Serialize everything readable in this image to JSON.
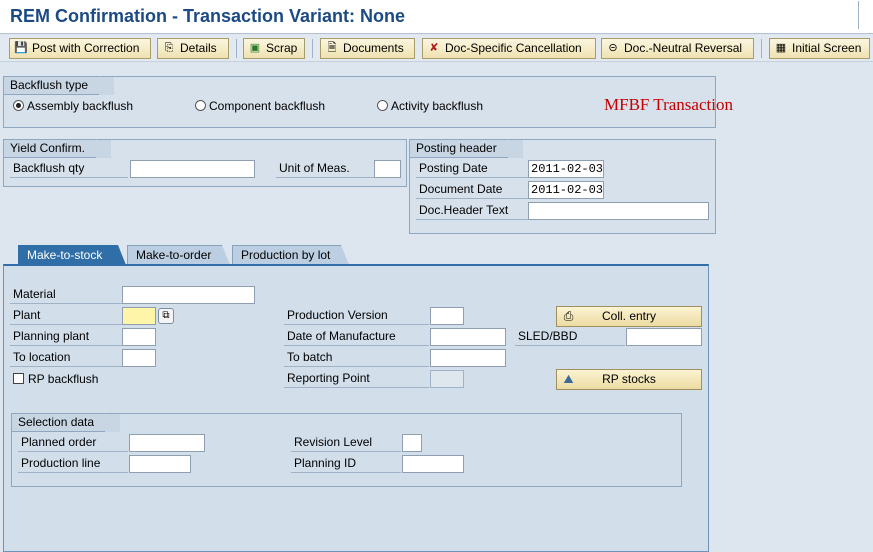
{
  "title": "REM Confirmation - Transaction Variant: None",
  "toolbar": {
    "buttons": [
      {
        "label": "Post with Correction",
        "icon": "save-icon"
      },
      {
        "label": "Details",
        "icon": "details-icon"
      },
      {
        "label": "Scrap",
        "icon": "scrap-icon"
      },
      {
        "label": "Documents",
        "icon": "documents-icon"
      },
      {
        "label": "Doc-Specific Cancellation",
        "icon": "cancel-doc-icon"
      },
      {
        "label": "Doc.-Neutral Reversal",
        "icon": "reversal-icon"
      },
      {
        "label": "Initial Screen",
        "icon": "initial-screen-icon"
      }
    ]
  },
  "backflush_type": {
    "title": "Backflush type",
    "options": [
      {
        "label": "Assembly backflush",
        "selected": true
      },
      {
        "label": "Component backflush",
        "selected": false
      },
      {
        "label": "Activity backflush",
        "selected": false
      }
    ]
  },
  "annotation": "MFBF Transaction",
  "yield_confirm": {
    "title": "Yield Confirm.",
    "backflush_qty_label": "Backflush qty",
    "backflush_qty_value": "",
    "unit_label": "Unit of Meas.",
    "unit_value": ""
  },
  "posting_header": {
    "title": "Posting header",
    "posting_date_label": "Posting Date",
    "posting_date_value": "2011-02-03",
    "document_date_label": "Document Date",
    "document_date_value": "2011-02-03",
    "doc_header_text_label": "Doc.Header Text",
    "doc_header_text_value": ""
  },
  "tabs": [
    {
      "label": "Make-to-stock",
      "active": true
    },
    {
      "label": "Make-to-order",
      "active": false
    },
    {
      "label": "Production by lot",
      "active": false
    }
  ],
  "make_to_stock": {
    "material_label": "Material",
    "plant_label": "Plant",
    "planning_plant_label": "Planning plant",
    "to_location_label": "To location",
    "rp_backflush_label": "RP backflush",
    "production_version_label": "Production Version",
    "date_of_manufacture_label": "Date of Manufacture",
    "to_batch_label": "To batch",
    "reporting_point_label": "Reporting Point",
    "sled_bbd_label": "SLED/BBD",
    "coll_entry_label": "Coll. entry",
    "rp_stocks_label": "RP stocks"
  },
  "selection_data": {
    "title": "Selection data",
    "planned_order_label": "Planned order",
    "production_line_label": "Production line",
    "revision_level_label": "Revision Level",
    "planning_id_label": "Planning ID"
  },
  "colors": {
    "title": "#1c4a84",
    "active_tab": "#2f6ea6",
    "required_field": "#fff5a8",
    "annotation": "#c40000"
  }
}
